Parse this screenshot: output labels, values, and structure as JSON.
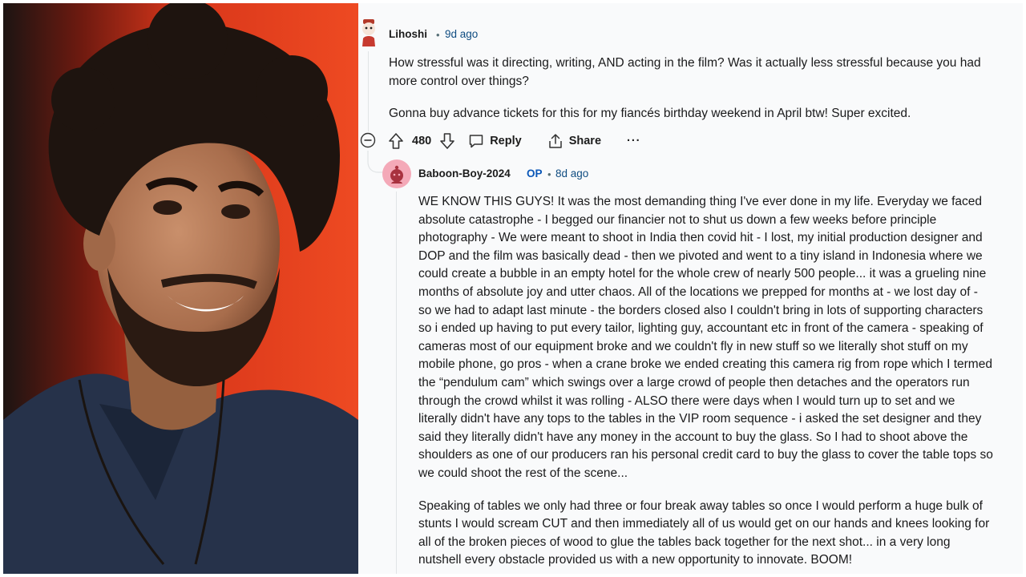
{
  "photo": {
    "alt_subject": "man-portrait-photo"
  },
  "comment": {
    "username": "Lihoshi",
    "separator": "•",
    "time": "9d ago",
    "paragraphs": [
      "How stressful was it directing, writing, AND acting in the film? Was it actually less stressful because you had",
      "more control over things?",
      "Gonna buy advance tickets for this for my fiancés birthday weekend in April btw! Super excited."
    ],
    "upvotes": "480",
    "reply_label": "Reply",
    "share_label": "Share",
    "more_label": "···"
  },
  "reply": {
    "username": "Baboon-Boy-2024",
    "op_badge": "OP",
    "separator": "•",
    "time": "8d ago",
    "lines_p1": [
      "WE KNOW THIS GUYS! It was the most demanding thing I've ever done in my life. Everyday we faced",
      "absolute catastrophe - I begged our financier not to shut us down a few weeks before principle",
      "photography - We were meant to shoot in India then covid hit - I lost, my initial production designer and",
      "DOP and the film was basically dead - then we pivoted and went to a tiny island in Indonesia where we",
      "could create a bubble in an empty hotel for the whole crew of nearly 500 people... it was a grueling nine",
      "months of absolute joy and utter chaos. All of the locations we prepped for months at - we lost day of -",
      "so we had to adapt last minute - the borders closed also I couldn't bring in lots of supporting characters",
      "so i ended up having to put every tailor, lighting guy, accountant etc in front of the camera - speaking of",
      "cameras most of our equipment broke and we couldn't fly in new stuff so we literally shot stuff on my",
      "mobile phone, go pros - when a crane broke we ended creating this camera rig from rope which I termed",
      "the “pendulum cam” which swings over a large crowd of people then detaches and the operators run",
      "through the crowd whilst it was rolling - ALSO there were days when I would turn up to set and we",
      "literally didn't have any tops to the tables in the VIP room sequence - i asked the set designer and they",
      "said they literally didn't have any money in the account to buy the glass. So I had to shoot above the",
      "shoulders as one of our producers ran his personal credit card to buy the glass to cover the table tops so",
      "we could shoot the rest of the scene..."
    ],
    "lines_p2": [
      "Speaking of tables we only had three or four break away tables so once I would perform a huge bulk of",
      "stunts I would scream CUT and then immediately all of us would get on our hands and knees looking for",
      "all of the broken pieces of wood to glue the tables back together for the next shot... in a very long",
      "nutshell every obstacle provided us with a new opportunity to innovate. BOOM!"
    ]
  },
  "icons": {
    "collapse": "collapse-minus-icon",
    "upvote": "upvote-arrow-icon",
    "downvote": "downvote-arrow-icon",
    "reply": "reply-bubble-icon",
    "share": "share-icon"
  },
  "colors": {
    "photo_background": "#e0391c",
    "op_badge": "#0a57b8",
    "time": "#0f4c81",
    "reply_avatar_bg": "#f4a9b8"
  }
}
